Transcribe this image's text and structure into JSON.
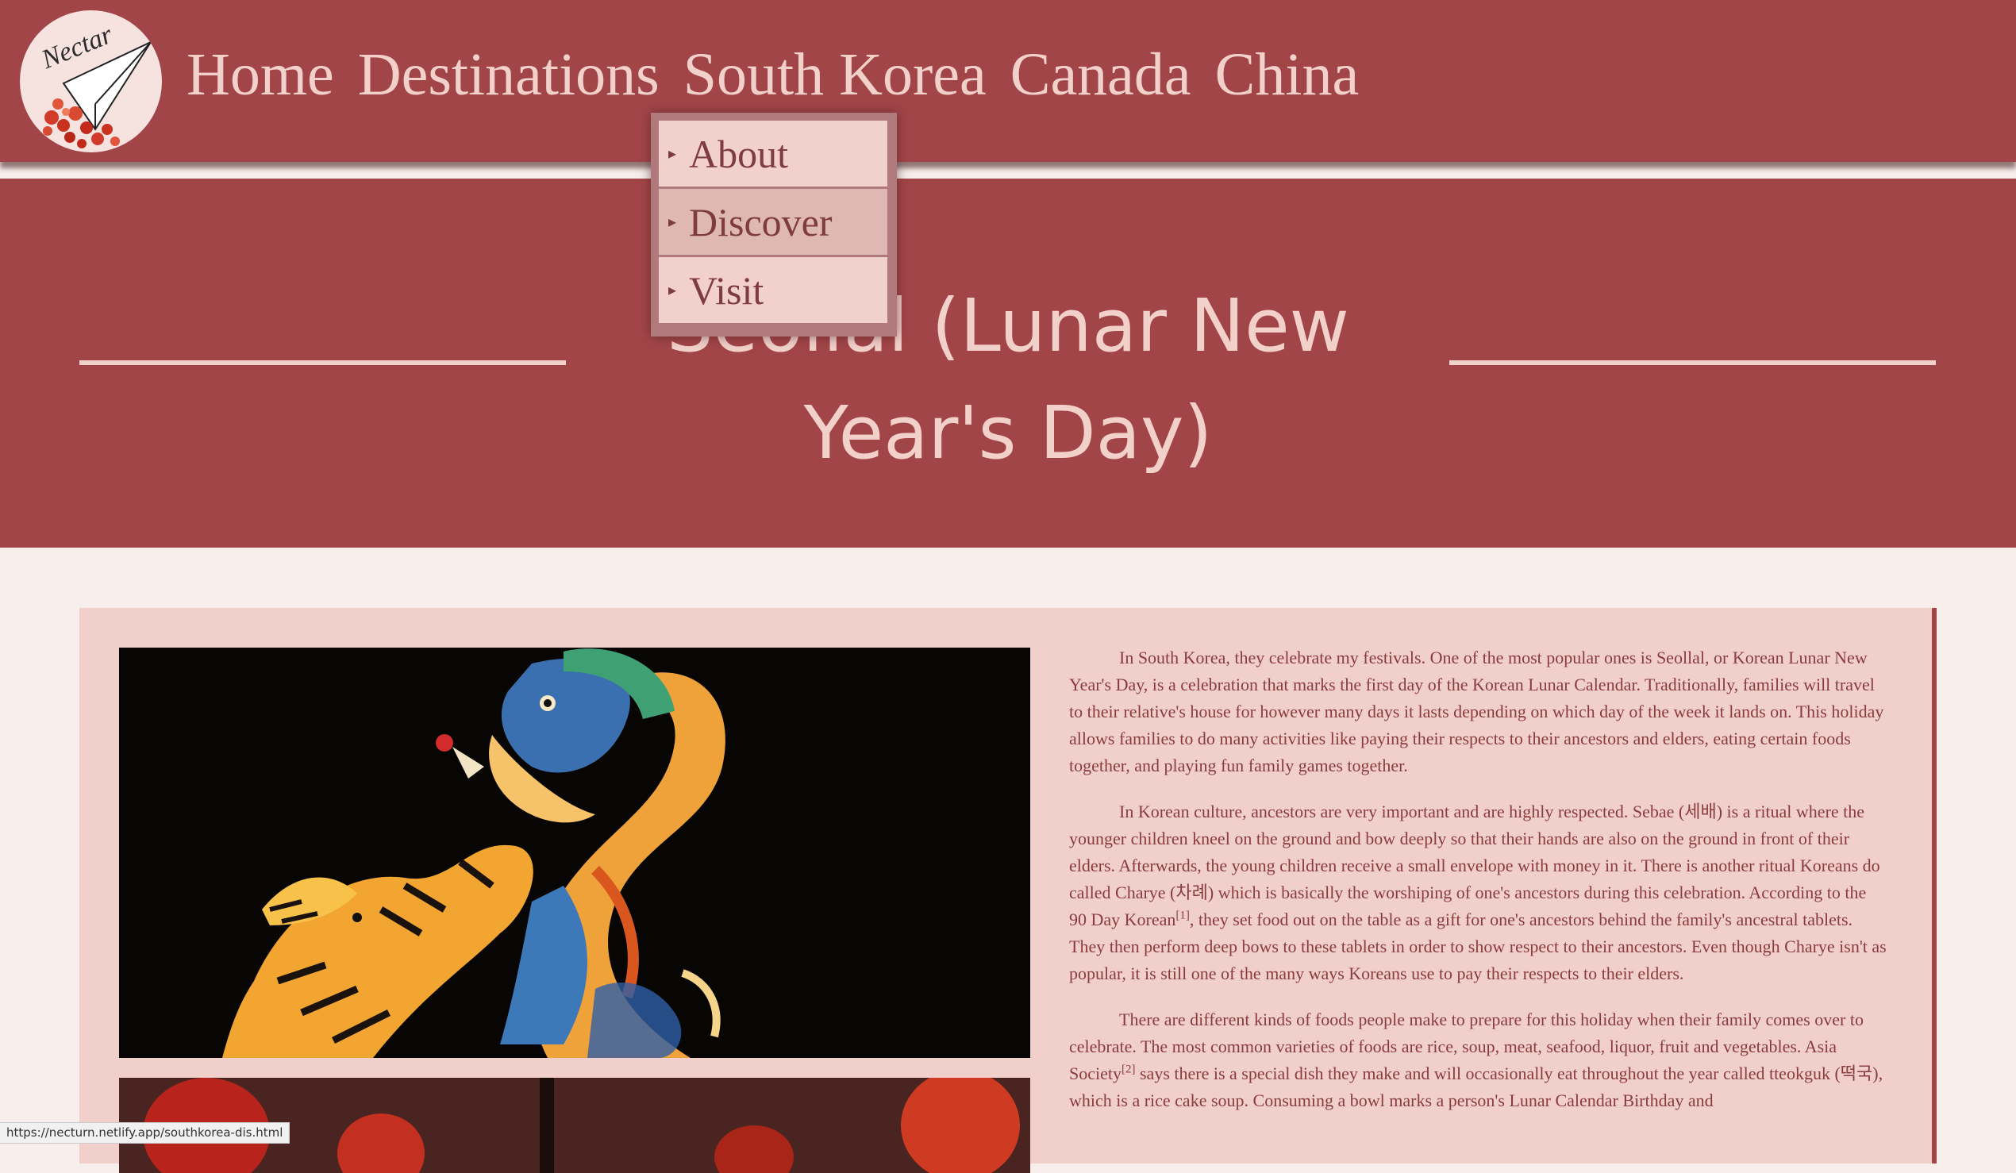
{
  "nav": {
    "logo_text": "Nectar",
    "links": [
      "Home",
      "Destinations",
      "South Korea",
      "Canada",
      "China"
    ]
  },
  "dropdown": {
    "items": [
      "About",
      "Discover",
      "Visit"
    ],
    "active": "Discover",
    "arrow": "▸"
  },
  "hero": {
    "title": "Seollal (Lunar New Year's Day)"
  },
  "article": {
    "p1": "In South Korea, they celebrate my festivals. One of the most popular ones is Seollal, or Korean Lunar New Year's Day, is a celebration that marks the first day of the Korean Lunar Calendar. Traditionally, families will travel to their relative's house for however many days it lasts depending on which day of the week it lands on. This holiday allows families to do many activities like paying their respects to their ancestors and elders, eating certain foods together, and playing fun family games together.",
    "p2a": "In Korean culture, ancestors are very important and are highly respected. Sebae (세배) is a ritual where the younger children kneel on the ground and bow deeply so that their hands are also on the ground in front of their elders. Afterwards, the young children receive a small envelope with money in it. There is another ritual Koreans do called Charye (차례) which is basically the worshiping of one's ancestors during this celebration. According to the 90 Day Korean",
    "p2_ref": "[1]",
    "p2b": ", they set food out on the table as a gift for one's ancestors behind the family's ancestral tablets. They then perform deep bows to these tablets in order to show respect to their ancestors. Even though Charye isn't as popular, it is still one of the many ways Koreans use to pay their respects to their elders.",
    "p3a": "There are different kinds of foods people make to prepare for this holiday when their family comes over to celebrate. The most common varieties of foods are rice, soup, meat, seafood, liquor, fruit and vegetables. Asia Society",
    "p3_ref": "[2]",
    "p3b": " says there is a special dish they make and will occasionally eat throughout the year called tteokguk (떡국), which is a rice cake soup. Consuming a bowl marks a person's Lunar Calendar Birthday and"
  },
  "status_url": "https://necturn.netlify.app/southkorea-dis.html",
  "colors": {
    "primary": "#a24549",
    "light": "#f3d1cb",
    "card": "#f1d0cb",
    "page_bg": "#f8efec",
    "dropdown_active": "#dfb8b4"
  }
}
